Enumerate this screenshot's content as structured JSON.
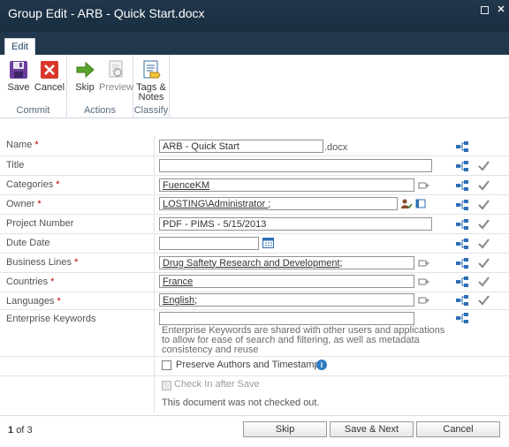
{
  "window": {
    "title": "Group Edit - ARB - Quick Start.docx",
    "maximize_glyph": "□",
    "close_glyph": "✕"
  },
  "tabs": [
    {
      "label": "Edit"
    }
  ],
  "ribbon": {
    "groups": [
      {
        "label": "Commit",
        "buttons": [
          {
            "label": "Save",
            "icon": "save-disk-icon"
          },
          {
            "label": "Cancel",
            "icon": "cancel-x-icon"
          }
        ]
      },
      {
        "label": "Actions",
        "buttons": [
          {
            "label": "Skip",
            "icon": "skip-arrow-icon"
          },
          {
            "label": "Preview",
            "icon": "preview-icon",
            "disabled": true
          }
        ]
      },
      {
        "label": "Classify",
        "buttons": [
          {
            "label": "Tags &",
            "label2": "Notes",
            "icon": "tags-notes-icon"
          }
        ]
      }
    ]
  },
  "fields": {
    "name": {
      "label": "Name",
      "required": "*",
      "value": "ARB - Quick Start",
      "suffix": ".docx"
    },
    "title": {
      "label": "Title",
      "value": ""
    },
    "categories": {
      "label": "Categories",
      "required": "*",
      "value": "FuenceKM"
    },
    "owner": {
      "label": "Owner",
      "required": "*",
      "value": "LOSTING\\Administrator ;"
    },
    "project_number": {
      "label": "Project Number",
      "value": "PDF - PIMS - 5/15/2013"
    },
    "dute_date": {
      "label": "Dute Date",
      "value": ""
    },
    "business_lines": {
      "label": "Business Lines",
      "required": "*",
      "value": "Drug Saftety Research and Development;"
    },
    "countries": {
      "label": "Countries",
      "required": "*",
      "value": "France"
    },
    "languages": {
      "label": "Languages",
      "required": "*",
      "value": "English;"
    },
    "enterprise_keywords": {
      "label": "Enterprise Keywords",
      "value": "",
      "help": "Enterprise Keywords are shared with other users and applications to allow for ease of search and filtering, as well as metadata consistency and reuse"
    }
  },
  "options": {
    "preserve": {
      "label": "Preserve Authors and Timestamps",
      "checked": false
    },
    "checkin": {
      "label": "Check In after Save",
      "checked": false,
      "disabled": true,
      "note": "This document was not checked out."
    }
  },
  "footer": {
    "pager": {
      "current": "1",
      "of_label": "of",
      "total": "3"
    },
    "buttons": {
      "skip": "Skip",
      "save_next": "Save & Next",
      "cancel": "Cancel"
    }
  },
  "colors": {
    "titlebar": "#21374c",
    "required": "#bf0000",
    "accent": "#2d7bc3"
  }
}
